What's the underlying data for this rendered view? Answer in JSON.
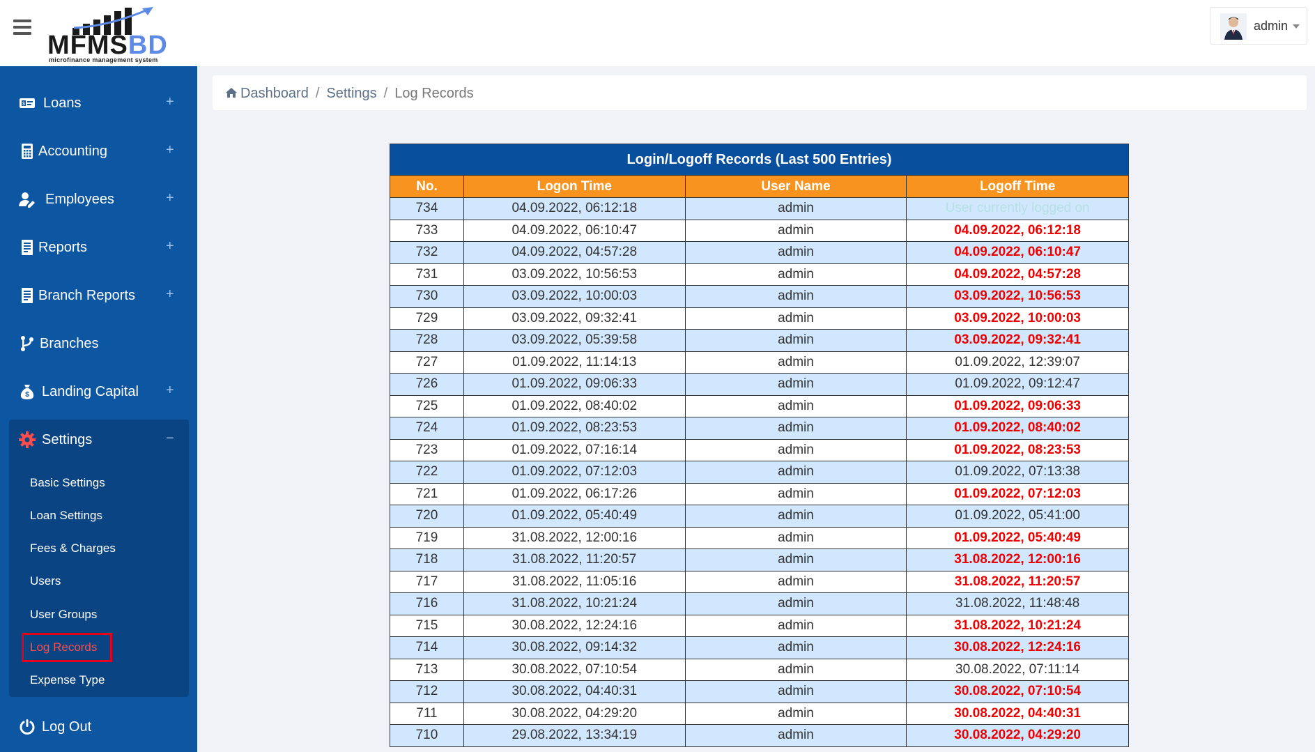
{
  "header": {
    "logo_text": "MFMS",
    "logo_text_accent": "BD",
    "logo_tagline": "microfinance management system",
    "user_name": "admin"
  },
  "sidebar": {
    "items": [
      {
        "label": "Loans",
        "icon": "loan-card-icon",
        "expandable": true
      },
      {
        "label": "Accounting",
        "icon": "calculator-icon",
        "expandable": true
      },
      {
        "label": "Employees",
        "icon": "user-edit-icon",
        "expandable": true
      },
      {
        "label": "Reports",
        "icon": "document-icon",
        "expandable": true
      },
      {
        "label": "Branch Reports",
        "icon": "document-icon",
        "expandable": true
      },
      {
        "label": "Branches",
        "icon": "code-branch-icon",
        "expandable": false
      },
      {
        "label": "Landing Capital",
        "icon": "money-bag-icon",
        "expandable": true
      },
      {
        "label": "Settings",
        "icon": "gear-icon",
        "expandable": true,
        "expanded": true
      },
      {
        "label": "Log Out",
        "icon": "power-icon",
        "expandable": false
      }
    ],
    "settings_children": [
      {
        "label": "Basic Settings"
      },
      {
        "label": "Loan Settings"
      },
      {
        "label": "Fees & Charges"
      },
      {
        "label": "Users"
      },
      {
        "label": "User Groups"
      },
      {
        "label": "Log Records",
        "active": true
      },
      {
        "label": "Expense Type"
      }
    ],
    "plus_symbol": "+",
    "minus_symbol": "−"
  },
  "breadcrumb": {
    "items": [
      "Dashboard",
      "Settings",
      "Log Records"
    ],
    "separator": "/"
  },
  "table": {
    "title": "Login/Logoff Records (Last 500 Entries)",
    "columns": [
      "No.",
      "Logon Time",
      "User Name",
      "Logoff Time"
    ],
    "rows": [
      {
        "no": "734",
        "logon": "04.09.2022, 06:12:18",
        "user": "admin",
        "logoff": "User currently logged on",
        "style": "current"
      },
      {
        "no": "733",
        "logon": "04.09.2022, 06:10:47",
        "user": "admin",
        "logoff": "04.09.2022, 06:12:18",
        "style": "red"
      },
      {
        "no": "732",
        "logon": "04.09.2022, 04:57:28",
        "user": "admin",
        "logoff": "04.09.2022, 06:10:47",
        "style": "red"
      },
      {
        "no": "731",
        "logon": "03.09.2022, 10:56:53",
        "user": "admin",
        "logoff": "04.09.2022, 04:57:28",
        "style": "red"
      },
      {
        "no": "730",
        "logon": "03.09.2022, 10:00:03",
        "user": "admin",
        "logoff": "03.09.2022, 10:56:53",
        "style": "red"
      },
      {
        "no": "729",
        "logon": "03.09.2022, 09:32:41",
        "user": "admin",
        "logoff": "03.09.2022, 10:00:03",
        "style": "red"
      },
      {
        "no": "728",
        "logon": "03.09.2022, 05:39:58",
        "user": "admin",
        "logoff": "03.09.2022, 09:32:41",
        "style": "red"
      },
      {
        "no": "727",
        "logon": "01.09.2022, 11:14:13",
        "user": "admin",
        "logoff": "01.09.2022, 12:39:07",
        "style": "normal"
      },
      {
        "no": "726",
        "logon": "01.09.2022, 09:06:33",
        "user": "admin",
        "logoff": "01.09.2022, 09:12:47",
        "style": "normal"
      },
      {
        "no": "725",
        "logon": "01.09.2022, 08:40:02",
        "user": "admin",
        "logoff": "01.09.2022, 09:06:33",
        "style": "red"
      },
      {
        "no": "724",
        "logon": "01.09.2022, 08:23:53",
        "user": "admin",
        "logoff": "01.09.2022, 08:40:02",
        "style": "red"
      },
      {
        "no": "723",
        "logon": "01.09.2022, 07:16:14",
        "user": "admin",
        "logoff": "01.09.2022, 08:23:53",
        "style": "red"
      },
      {
        "no": "722",
        "logon": "01.09.2022, 07:12:03",
        "user": "admin",
        "logoff": "01.09.2022, 07:13:38",
        "style": "normal"
      },
      {
        "no": "721",
        "logon": "01.09.2022, 06:17:26",
        "user": "admin",
        "logoff": "01.09.2022, 07:12:03",
        "style": "red"
      },
      {
        "no": "720",
        "logon": "01.09.2022, 05:40:49",
        "user": "admin",
        "logoff": "01.09.2022, 05:41:00",
        "style": "normal"
      },
      {
        "no": "719",
        "logon": "31.08.2022, 12:00:16",
        "user": "admin",
        "logoff": "01.09.2022, 05:40:49",
        "style": "red"
      },
      {
        "no": "718",
        "logon": "31.08.2022, 11:20:57",
        "user": "admin",
        "logoff": "31.08.2022, 12:00:16",
        "style": "red"
      },
      {
        "no": "717",
        "logon": "31.08.2022, 11:05:16",
        "user": "admin",
        "logoff": "31.08.2022, 11:20:57",
        "style": "red"
      },
      {
        "no": "716",
        "logon": "31.08.2022, 10:21:24",
        "user": "admin",
        "logoff": "31.08.2022, 11:48:48",
        "style": "normal"
      },
      {
        "no": "715",
        "logon": "30.08.2022, 12:24:16",
        "user": "admin",
        "logoff": "31.08.2022, 10:21:24",
        "style": "red"
      },
      {
        "no": "714",
        "logon": "30.08.2022, 09:14:32",
        "user": "admin",
        "logoff": "30.08.2022, 12:24:16",
        "style": "red"
      },
      {
        "no": "713",
        "logon": "30.08.2022, 07:10:54",
        "user": "admin",
        "logoff": "30.08.2022, 07:11:14",
        "style": "normal"
      },
      {
        "no": "712",
        "logon": "30.08.2022, 04:40:31",
        "user": "admin",
        "logoff": "30.08.2022, 07:10:54",
        "style": "red"
      },
      {
        "no": "711",
        "logon": "30.08.2022, 04:29:20",
        "user": "admin",
        "logoff": "30.08.2022, 04:40:31",
        "style": "red"
      },
      {
        "no": "710",
        "logon": "29.08.2022, 13:34:19",
        "user": "admin",
        "logoff": "30.08.2022, 04:29:20",
        "style": "red"
      }
    ]
  },
  "colors": {
    "sidebar_bg": "#0d56a2",
    "table_title_bg": "#08509d",
    "table_header_bg": "#f7931e",
    "row_alt_bg": "#d0e7fe",
    "logoff_red": "#ee0000",
    "active_link": "#ff4d4d"
  }
}
